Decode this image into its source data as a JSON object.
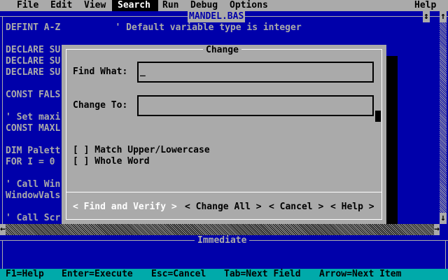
{
  "menubar": {
    "items": [
      "File",
      "Edit",
      "View",
      "Search",
      "Run",
      "Debug",
      "Options"
    ],
    "help": "Help"
  },
  "editor": {
    "filename": "MANDEL.BAS",
    "lines": [
      "DEFINT A-Z          ' Default variable type is integer",
      "",
      "DECLARE SU",
      "DECLARE SU",
      "DECLARE SU",
      "",
      "CONST FALS",
      "",
      "' Set maxi",
      "CONST MAXL",
      "",
      "DIM Palett",
      "FOR I = 0",
      "",
      "' Call Win",
      "WindowVals",
      "",
      "' Call Scr"
    ]
  },
  "scrollbar": {
    "up": "↑",
    "down": "↓",
    "left": "←",
    "right": "→"
  },
  "immediate": {
    "title": "Immediate"
  },
  "dialog": {
    "title": "Change",
    "find_label": "Find What:",
    "find_value": "_",
    "change_label": "Change To:",
    "change_value": "",
    "options": [
      "[ ] Match Upper/Lowercase",
      "[ ] Whole Word"
    ],
    "buttons": [
      "< Find and Verify >",
      "< Change All >",
      "< Cancel >",
      "< Help >"
    ]
  },
  "statusbar": {
    "items": [
      "F1=Help",
      "Enter=Execute",
      "Esc=Cancel",
      "Tab=Next Field",
      "Arrow=Next Item"
    ]
  },
  "colors": {
    "background": "#0000aa",
    "gray": "#aaaaaa",
    "status": "#00aaaa"
  }
}
